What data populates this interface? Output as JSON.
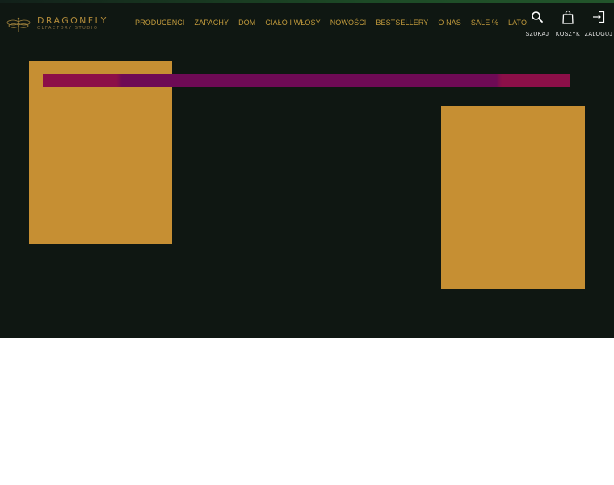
{
  "logo": {
    "name": "DRAGONFLY",
    "tagline": "OLFACTORY STUDIO",
    "icon": "dragonfly-icon"
  },
  "nav": {
    "items": [
      "PRODUCENCI",
      "ZAPACHY",
      "DOM",
      "CIAŁO I WŁOSY",
      "NOWOŚCI",
      "BESTSELLERY",
      "O NAS",
      "SALE %",
      "LATO!"
    ]
  },
  "actions": {
    "search": {
      "label": "SZUKAJ",
      "icon": "search-icon"
    },
    "cart": {
      "label": "KOSZYK",
      "icon": "bag-icon"
    },
    "login": {
      "label": "ZALOGUJ",
      "icon": "login-icon"
    }
  },
  "colors": {
    "header_bg": "#0f1712",
    "gold": "#c19a3c",
    "box": "#c68f33",
    "banner_edge": "#8c0f48",
    "banner_center": "#6e0a55"
  }
}
